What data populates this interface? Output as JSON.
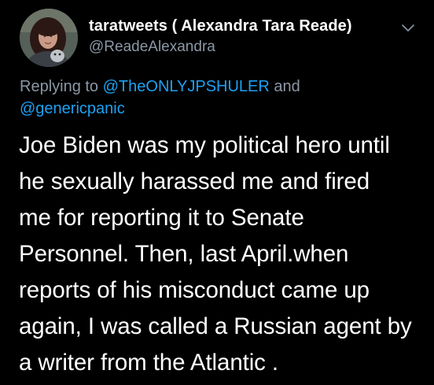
{
  "author": {
    "display_name": "taratweets ( Alexandra Tara Reade)",
    "handle": "@ReadeAlexandra",
    "avatar_icon": "profile-photo"
  },
  "reply": {
    "prefix": "Replying to",
    "mention_1": "@TheONLYJPSHULER",
    "joiner": "and",
    "mention_2": "@genericpanic"
  },
  "tweet": {
    "lines": [
      "Joe Biden was my political hero until",
      "he sexually harassed me and fired",
      "me for reporting it to Senate",
      "Personnel. Then, last April.when",
      "reports of his misconduct came up",
      "again, I was called a Russian agent by",
      "a writer from the Atlantic ."
    ]
  },
  "colors": {
    "background": "#000000",
    "text": "#ffffff",
    "secondary": "#8b98a5",
    "link": "#1da1f2"
  },
  "icons": {
    "menu": "chevron-down-icon"
  }
}
